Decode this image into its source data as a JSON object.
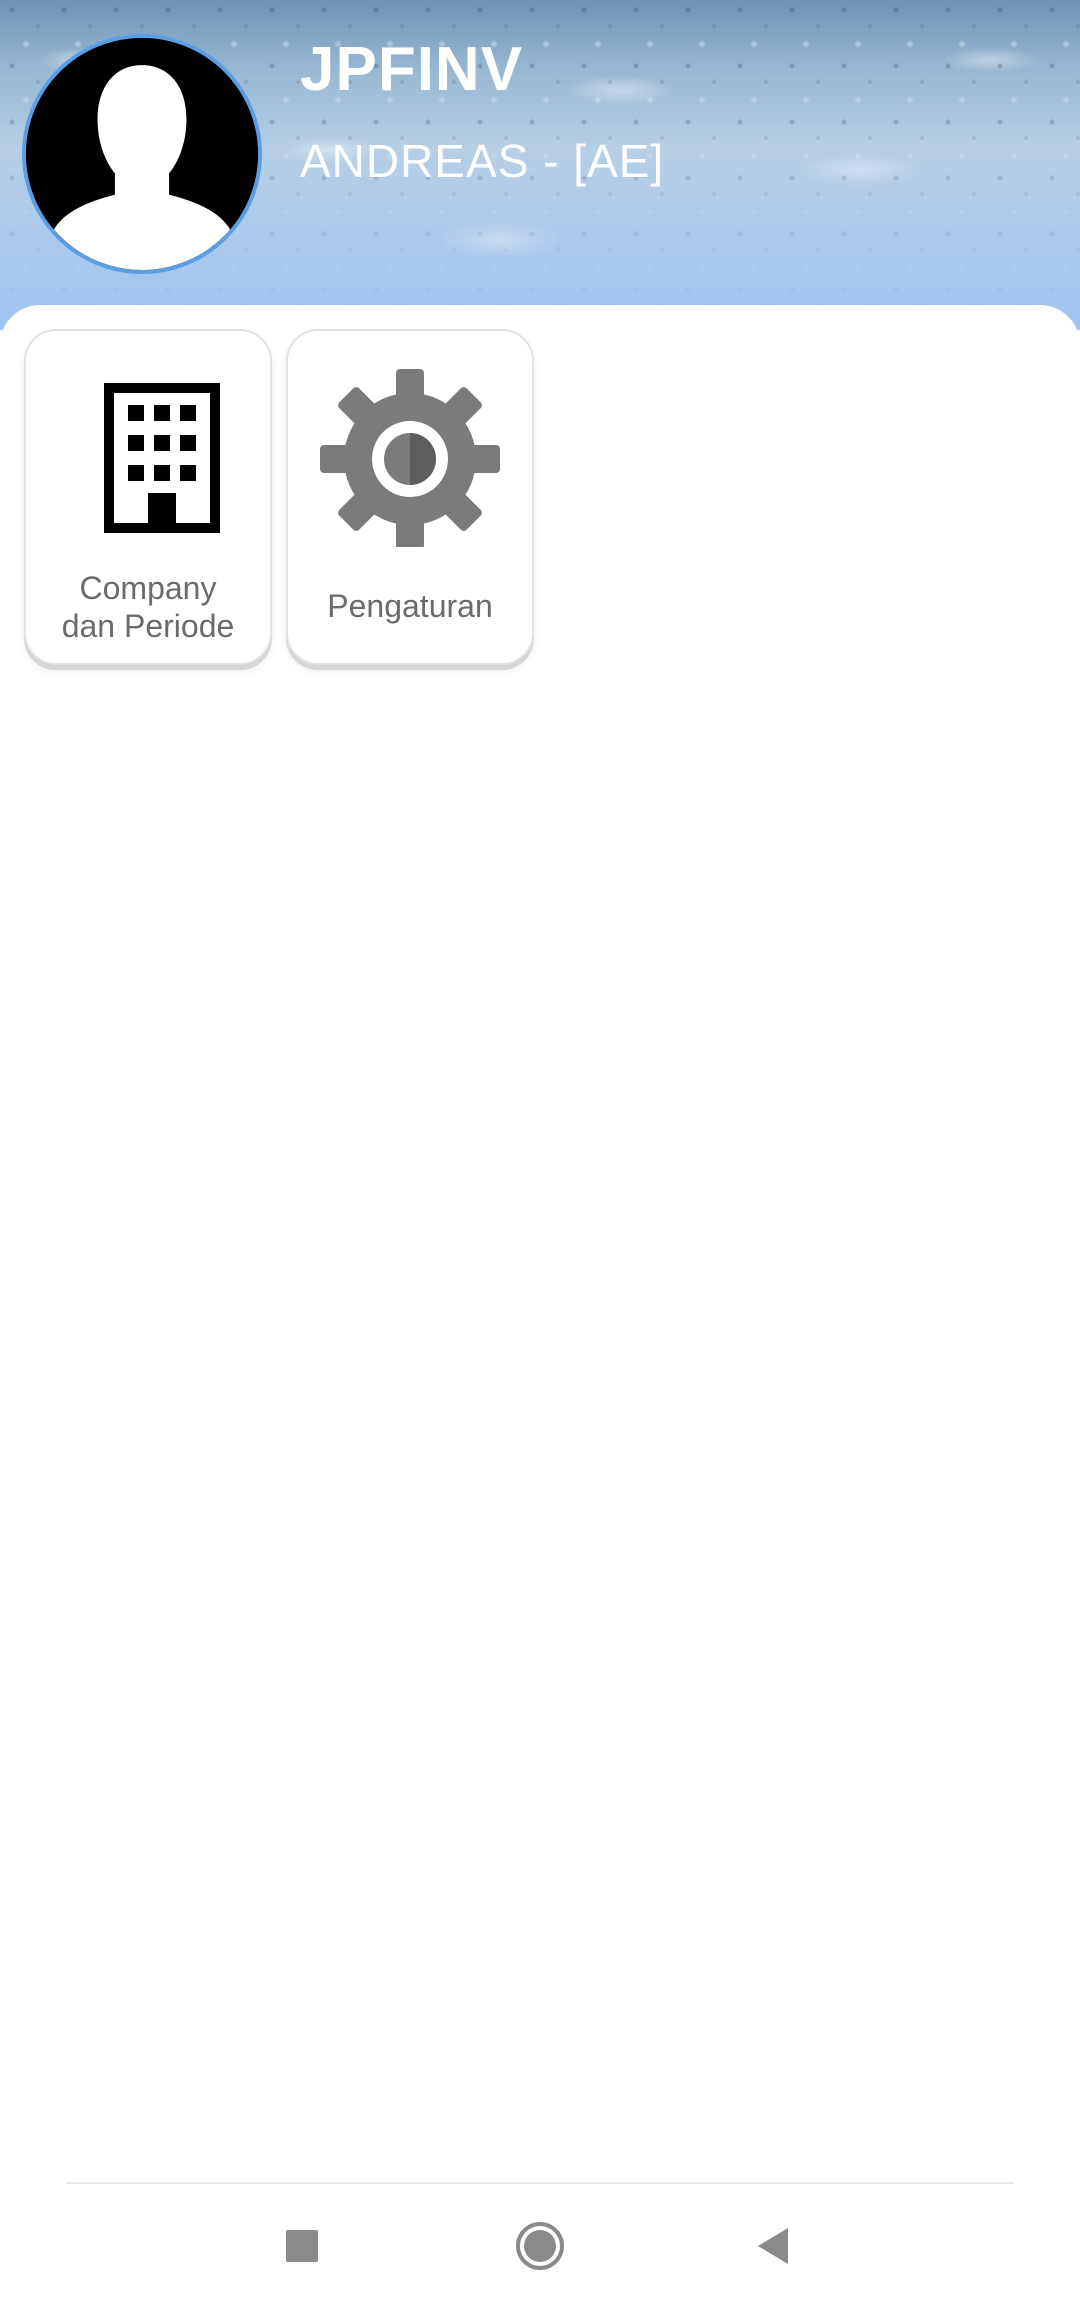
{
  "header": {
    "app_title": "JPFINV",
    "user_label": "ANDREAS - [AE]",
    "avatar_icon": "user-silhouette-icon"
  },
  "menu": {
    "items": [
      {
        "label": "Company\ndan Periode",
        "icon": "building-icon"
      },
      {
        "label": "Pengaturan",
        "icon": "gear-icon"
      }
    ]
  },
  "navigation_bar": {
    "buttons": [
      {
        "name": "recents",
        "icon": "square-icon"
      },
      {
        "name": "home",
        "icon": "circle-icon"
      },
      {
        "name": "back",
        "icon": "triangle-back-icon"
      }
    ]
  },
  "colors": {
    "avatar_ring": "#5b9ee4",
    "tile_text": "#6b6b6b",
    "nav_icon": "#8a8a8a"
  }
}
